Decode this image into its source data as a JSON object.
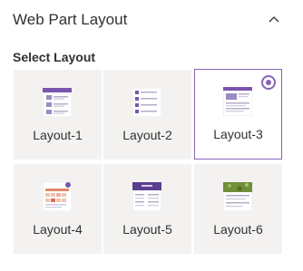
{
  "panel": {
    "title": "Web Part Layout",
    "collapse_icon": "chevron-up-icon"
  },
  "section": {
    "label": "Select Layout"
  },
  "layouts": [
    {
      "label": "Layout-1",
      "selected": false
    },
    {
      "label": "Layout-2",
      "selected": false
    },
    {
      "label": "Layout-3",
      "selected": true
    },
    {
      "label": "Layout-4",
      "selected": false
    },
    {
      "label": "Layout-5",
      "selected": false
    },
    {
      "label": "Layout-6",
      "selected": false
    }
  ],
  "colors": {
    "accent": "#8764b8",
    "tile_bg": "#f3f2f1",
    "text": "#323130"
  }
}
